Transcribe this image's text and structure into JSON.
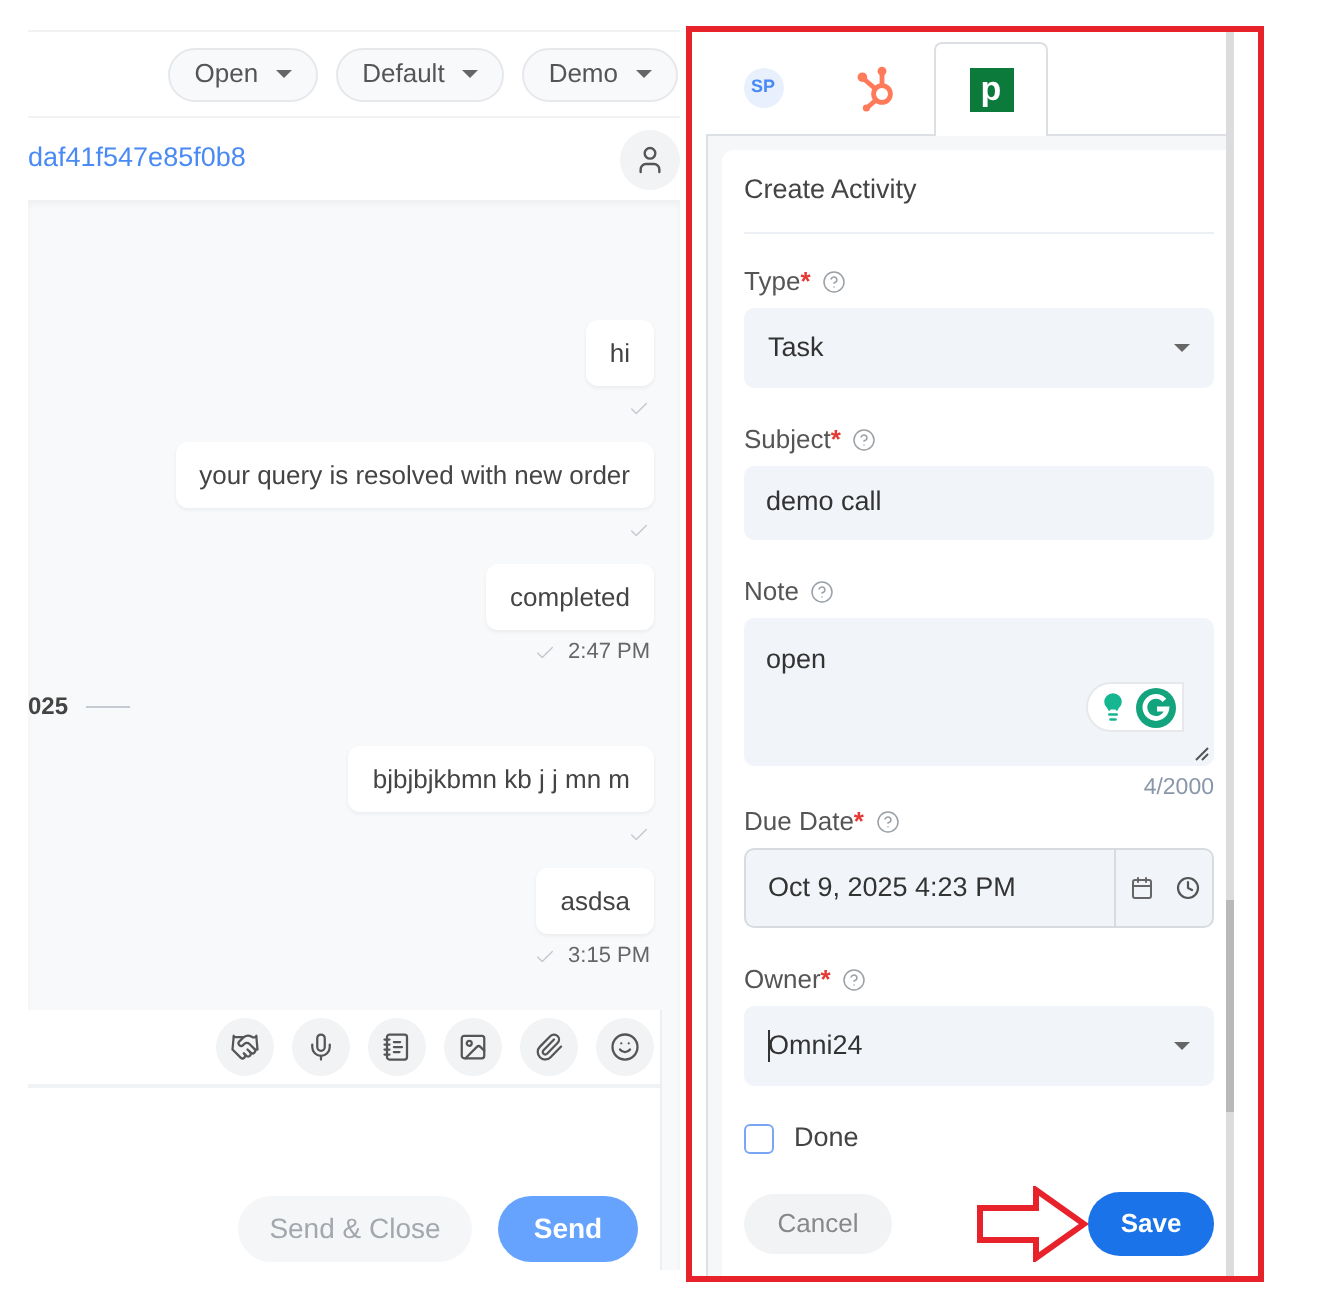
{
  "filters": [
    {
      "label": "Open"
    },
    {
      "label": "Default"
    },
    {
      "label": "Demo"
    }
  ],
  "conversation": {
    "id": "daf41f547e85f0b8"
  },
  "messages": [
    {
      "kind": "message",
      "text": "hi",
      "sent": true
    },
    {
      "kind": "message",
      "text": "your query is resolved with new order",
      "sent": true
    },
    {
      "kind": "message",
      "text": "completed",
      "sent": true,
      "time": "2:47 PM"
    },
    {
      "kind": "date",
      "text": "025"
    },
    {
      "kind": "message",
      "text": "bjbjbjkbmn kb j j mn m",
      "sent": true
    },
    {
      "kind": "message",
      "text": "asdsa",
      "sent": true,
      "time": "3:15 PM"
    }
  ],
  "composer": {
    "buttons": [
      {
        "kind": "secondary",
        "label": "Send & Close",
        "disabled": true
      },
      {
        "kind": "primary",
        "label": "Send",
        "disabled": true
      }
    ]
  },
  "integrations": [
    {
      "kind": "avatar",
      "label": "SP",
      "selected": false
    },
    {
      "kind": "sprocket",
      "selected": false
    },
    {
      "kind": "badge",
      "label": "p",
      "selected": true
    }
  ],
  "activity_form": {
    "title": "Create Activity",
    "fields": [
      {
        "kind": "select",
        "label": "Type",
        "required_mark": "*",
        "value": "Task",
        "focused": false
      },
      {
        "kind": "text",
        "label": "Subject",
        "required_mark": "*",
        "value": "demo call",
        "focused": false
      },
      {
        "kind": "textarea",
        "label": "Note",
        "value": "open",
        "counter": "4/2000",
        "focused": false
      },
      {
        "kind": "datetime",
        "label": "Due Date",
        "required_mark": "*",
        "value": "Oct 9, 2025 4:23 PM",
        "focused": false
      },
      {
        "kind": "select",
        "label": "Owner",
        "required_mark": "*",
        "value": "Omni24",
        "focused": true
      }
    ],
    "checkbox": {
      "label": "Done",
      "checked": false
    },
    "buttons": [
      {
        "kind": "secondary",
        "label": "Cancel"
      },
      {
        "kind": "primary",
        "label": "Save"
      }
    ]
  }
}
